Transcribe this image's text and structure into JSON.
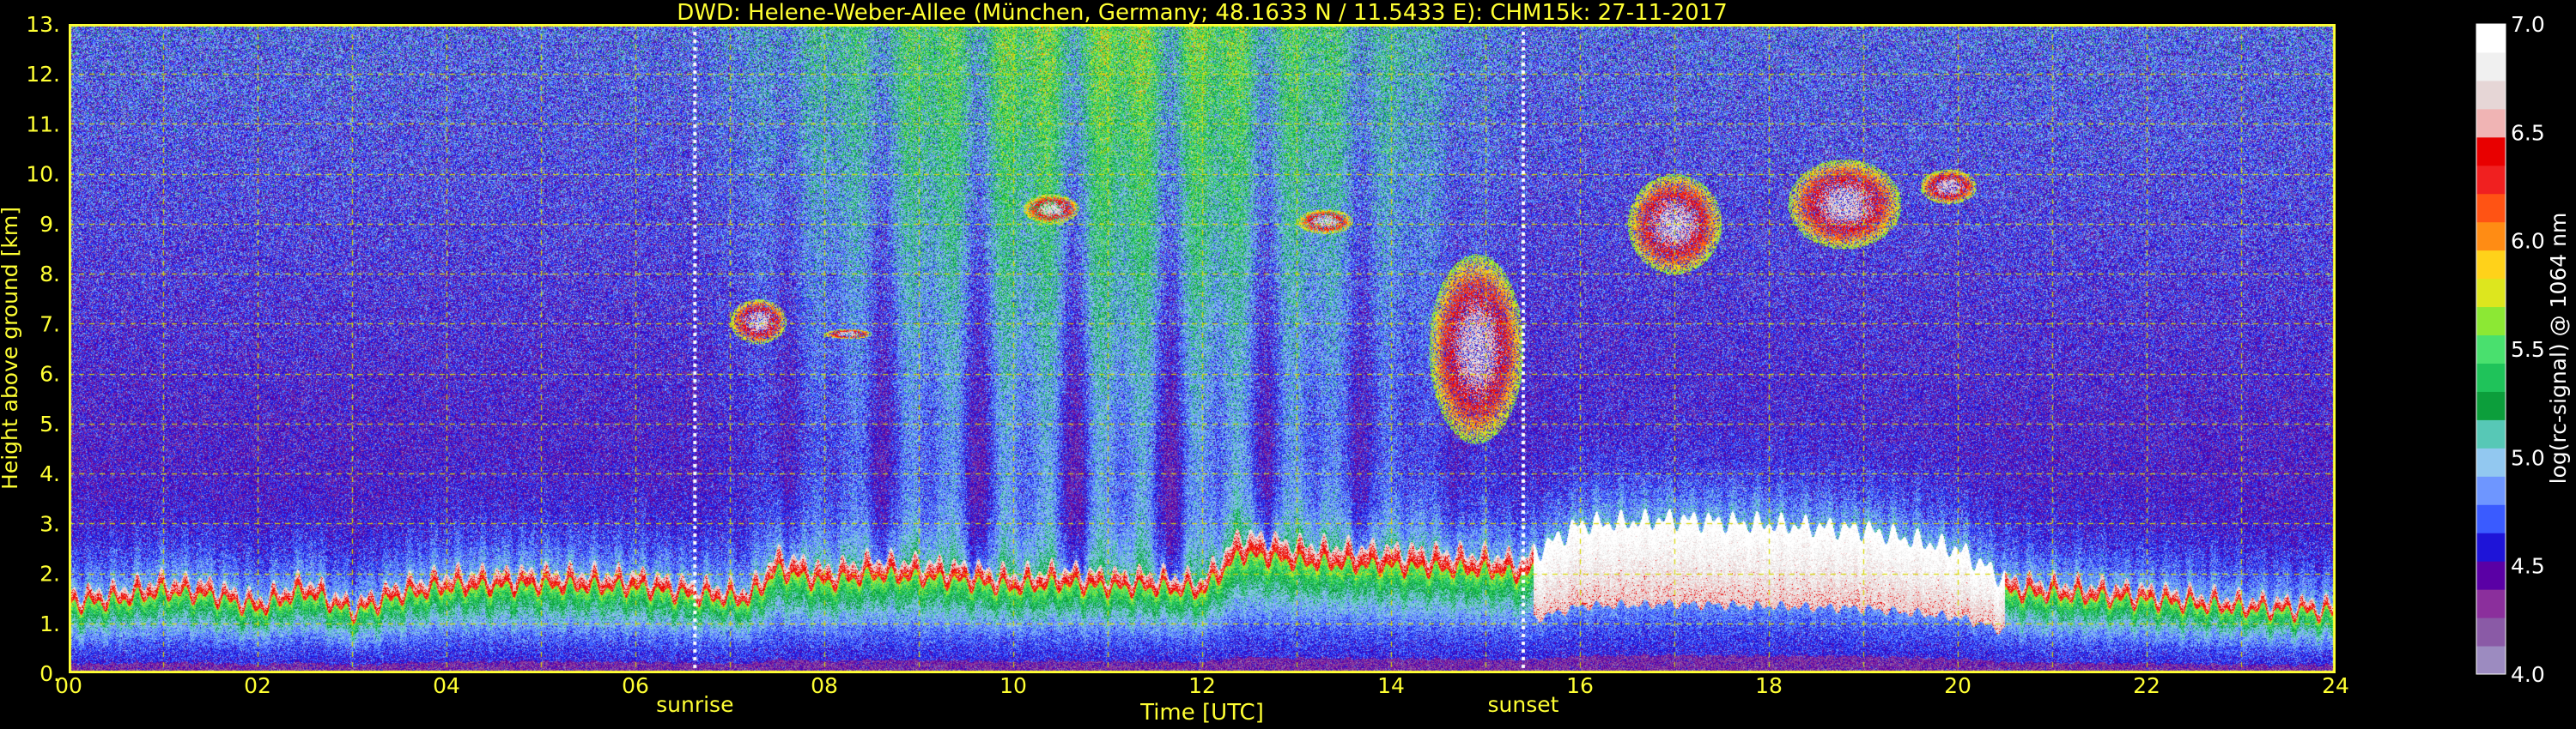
{
  "chart_data": {
    "type": "heatmap",
    "title": "DWD: Helene-Weber-Allee (München, Germany; 48.1633 N / 11.5433 E):    CHM15k: 27-11-2017",
    "xlabel": "Time [UTC]",
    "ylabel": "Height above ground [km]",
    "colorbar_label": "log(rc-signal) @ 1064 nm",
    "xlim": [
      0,
      24
    ],
    "ylim": [
      0,
      13
    ],
    "x_ticks": [
      {
        "value": 0,
        "label": "00"
      },
      {
        "value": 2,
        "label": "02"
      },
      {
        "value": 4,
        "label": "04"
      },
      {
        "value": 6,
        "label": "06"
      },
      {
        "value": 8,
        "label": "08"
      },
      {
        "value": 10,
        "label": "10"
      },
      {
        "value": 12,
        "label": "12"
      },
      {
        "value": 14,
        "label": "14"
      },
      {
        "value": 16,
        "label": "16"
      },
      {
        "value": 18,
        "label": "18"
      },
      {
        "value": 20,
        "label": "20"
      },
      {
        "value": 22,
        "label": "22"
      },
      {
        "value": 24,
        "label": "24"
      }
    ],
    "y_ticks": [
      {
        "value": 0,
        "label": "0."
      },
      {
        "value": 1,
        "label": "1."
      },
      {
        "value": 2,
        "label": "2."
      },
      {
        "value": 3,
        "label": "3."
      },
      {
        "value": 4,
        "label": "4."
      },
      {
        "value": 5,
        "label": "5."
      },
      {
        "value": 6,
        "label": "6."
      },
      {
        "value": 7,
        "label": "7."
      },
      {
        "value": 8,
        "label": "8."
      },
      {
        "value": 9,
        "label": "9."
      },
      {
        "value": 10,
        "label": "10."
      },
      {
        "value": 11,
        "label": "11."
      },
      {
        "value": 12,
        "label": "12."
      },
      {
        "value": 13,
        "label": "13."
      }
    ],
    "colorbar_range": [
      4.0,
      7.0
    ],
    "colorbar_ticks": [
      {
        "value": 4.0,
        "label": "4.0"
      },
      {
        "value": 4.5,
        "label": "4.5"
      },
      {
        "value": 5.0,
        "label": "5.0"
      },
      {
        "value": 5.5,
        "label": "5.5"
      },
      {
        "value": 6.0,
        "label": "6.0"
      },
      {
        "value": 6.5,
        "label": "6.5"
      },
      {
        "value": 7.0,
        "label": "7.0"
      }
    ],
    "events": [
      {
        "label": "sunrise",
        "time": 6.63
      },
      {
        "label": "sunset",
        "time": 15.4
      }
    ],
    "grid": true,
    "boundary_layer_top_km": [
      [
        0,
        1.6
      ],
      [
        0.5,
        1.7
      ],
      [
        1,
        1.9
      ],
      [
        1.5,
        1.8
      ],
      [
        2,
        1.5
      ],
      [
        2.5,
        1.9
      ],
      [
        3,
        1.4
      ],
      [
        3.5,
        1.8
      ],
      [
        4,
        2.0
      ],
      [
        5,
        2.05
      ],
      [
        6,
        2.0
      ],
      [
        6.6,
        1.8
      ],
      [
        7.2,
        1.7
      ],
      [
        7.5,
        2.4
      ],
      [
        8,
        2.1
      ],
      [
        8.5,
        2.3
      ],
      [
        9.3,
        2.2
      ],
      [
        10,
        2.0
      ],
      [
        10.5,
        2.1
      ],
      [
        11,
        2.0
      ],
      [
        11.5,
        2.0
      ],
      [
        12,
        1.9
      ],
      [
        12.4,
        2.8
      ],
      [
        13,
        2.6
      ],
      [
        14,
        2.5
      ],
      [
        15,
        2.4
      ],
      [
        15.4,
        2.3
      ],
      [
        16,
        3.0
      ],
      [
        17,
        3.1
      ],
      [
        18,
        3.0
      ],
      [
        19,
        2.9
      ],
      [
        20,
        2.5
      ],
      [
        20.5,
        1.9
      ],
      [
        22,
        1.7
      ],
      [
        23,
        1.5
      ],
      [
        24,
        1.4
      ]
    ],
    "cirrus_layers": [
      {
        "t_start": 7.0,
        "t_end": 7.6,
        "base_km": 6.6,
        "top_km": 7.5
      },
      {
        "t_start": 8.0,
        "t_end": 8.5,
        "base_km": 6.7,
        "top_km": 6.9
      },
      {
        "t_start": 10.1,
        "t_end": 10.7,
        "base_km": 9.0,
        "top_km": 9.6
      },
      {
        "t_start": 13.0,
        "t_end": 13.6,
        "base_km": 8.8,
        "top_km": 9.3
      },
      {
        "t_start": 14.4,
        "t_end": 15.4,
        "base_km": 4.6,
        "top_km": 8.4
      },
      {
        "t_start": 16.5,
        "t_end": 17.5,
        "base_km": 8.0,
        "top_km": 10.0
      },
      {
        "t_start": 18.2,
        "t_end": 19.4,
        "base_km": 8.5,
        "top_km": 10.3
      },
      {
        "t_start": 19.6,
        "t_end": 20.2,
        "base_km": 9.4,
        "top_km": 10.1
      }
    ]
  },
  "colors": {
    "background": "#000000",
    "text": "#FFFF33",
    "colorbar_text": "#FFFFFF",
    "grid": "#D8D800",
    "event_line": "#FFFFFF",
    "colormap": [
      "#9C8BC0",
      "#8A5AA6",
      "#8B2F9C",
      "#5A00A5",
      "#1E14D8",
      "#3A5BFF",
      "#6E96FF",
      "#92C8F0",
      "#57C8B6",
      "#0C9E3B",
      "#1FC35A",
      "#49E06E",
      "#8CE834",
      "#DDE61E",
      "#FFD21A",
      "#FF8C14",
      "#FF5314",
      "#F02020",
      "#E80000",
      "#F0B4B4",
      "#E6D6D6",
      "#F0F0F0",
      "#FFFFFF"
    ]
  }
}
